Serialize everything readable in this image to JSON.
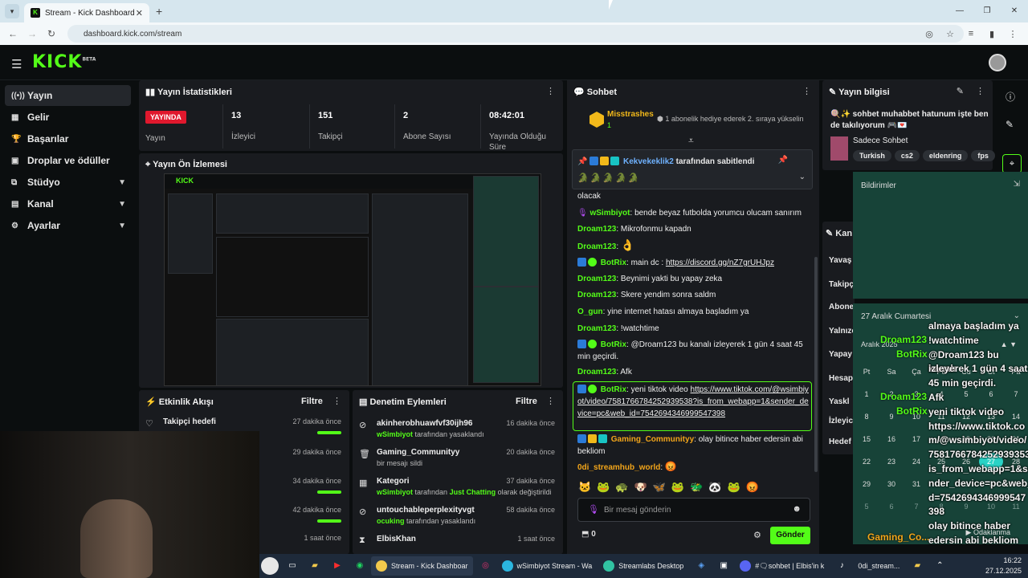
{
  "browser": {
    "tab_title": "Stream - Kick Dashboard",
    "url": "dashboard.kick.com/stream"
  },
  "logo": {
    "text": "KICK",
    "beta": "BETA"
  },
  "sidebar": {
    "items": [
      {
        "label": "Yayın",
        "icon": "radio-icon"
      },
      {
        "label": "Gelir",
        "icon": "money-icon"
      },
      {
        "label": "Başarılar",
        "icon": "trophy-icon"
      },
      {
        "label": "Droplar ve ödüller",
        "icon": "gift-icon"
      },
      {
        "label": "Stüdyo",
        "icon": "studio-icon"
      },
      {
        "label": "Kanal",
        "icon": "channel-icon"
      },
      {
        "label": "Ayarlar",
        "icon": "gear-icon"
      }
    ]
  },
  "stats": {
    "title": "Yayın İstatistikleri",
    "live_badge": "YAYINDA",
    "live_label": "Yayın",
    "items": [
      {
        "value": "13",
        "label": "İzleyici"
      },
      {
        "value": "151",
        "label": "Takipçi"
      },
      {
        "value": "2",
        "label": "Abone Sayısı"
      },
      {
        "value": "08:42:01",
        "label": "Yayında Olduğu Süre"
      }
    ]
  },
  "preview": {
    "title": "Yayın Ön İzlemesi"
  },
  "activity": {
    "title": "Etkinlik Akışı",
    "filter": "Filtre",
    "rows": [
      {
        "title": "Takipçi hedefi",
        "sub": "",
        "time": "27 dakika önce",
        "progress": 1.0
      },
      {
        "title": "",
        "sub": "",
        "time": "29 dakika önce",
        "progress": null
      },
      {
        "title": "",
        "sub": "",
        "time": "34 dakika önce",
        "progress": 1.0
      },
      {
        "title": "",
        "sub": "",
        "time": "42 dakika önce",
        "progress": 1.0
      },
      {
        "title": "",
        "sub": "",
        "time": "1 saat önce",
        "progress": null
      }
    ]
  },
  "moderation": {
    "title": "Denetim Eylemleri",
    "filter": "Filtre",
    "rows": [
      {
        "title": "akinherobhuawfvf30ijh96",
        "user": "wSimbiyot",
        "rest": " tarafından yasaklandı",
        "time": "16 dakika önce",
        "icon": "ban-icon"
      },
      {
        "title": "Gaming_Communityy",
        "user": "",
        "rest": "bir mesajı sildi",
        "time": "20 dakika önce",
        "icon": "trash-icon"
      },
      {
        "title": "Kategori",
        "user": "wSimbiyot",
        "rest": " tarafından ",
        "extra": "Just Chatting",
        "rest2": " olarak değiştirildi",
        "time": "37 dakika önce",
        "icon": "category-icon"
      },
      {
        "title": "untouchableperplexityvgt",
        "user": "ocuking",
        "rest": " tarafından yasaklandı",
        "time": "58 dakika önce",
        "icon": "ban-icon"
      },
      {
        "title": "ElbisKhan",
        "user": "",
        "rest": "",
        "time": "1 saat önce",
        "icon": "hourglass-icon"
      }
    ]
  },
  "chat": {
    "title": "Sohbet",
    "top_user": "Misstrashes",
    "top_count": "1",
    "gift_text": "1 abonelik hediye ederek 2. sıraya yükselin",
    "pinned_user": "Kekvekeklik2",
    "pinned_text": "tarafından sabitlendi",
    "messages": [
      {
        "user": "",
        "text": "olacak",
        "color": "#eeeeee"
      },
      {
        "user": "wSimbiyot",
        "text": "bende beyaz futbolda yorumcu olucam sanırım",
        "color": "#53fc18"
      },
      {
        "user": "Droam123",
        "text": "Mikrofonmu kapadn",
        "color": "#53fc18"
      },
      {
        "user": "Droam123",
        "text": "👌",
        "color": "#53fc18"
      },
      {
        "user": "BotRix",
        "text": "main dc : ",
        "link": "https://discord.gg/nZ7grUHJpz",
        "color": "#53fc18"
      },
      {
        "user": "Droam123",
        "text": "Beynimi yakti bu yapay zeka",
        "color": "#53fc18"
      },
      {
        "user": "Droam123",
        "text": "Skere yendim sonra saldm",
        "color": "#53fc18"
      },
      {
        "user": "O_gun",
        "text": "yine internet hatası almaya başladım ya",
        "color": "#53fc18"
      },
      {
        "user": "Droam123",
        "text": "!watchtime",
        "color": "#53fc18"
      },
      {
        "user": "BotRix",
        "text": "@Droam123 bu kanalı izleyerek 1 gün 4 saat 45 min geçirdi.",
        "color": "#53fc18"
      },
      {
        "user": "Droam123",
        "text": "Afk",
        "color": "#53fc18"
      },
      {
        "user": "BotRix",
        "text": "yeni tiktok video",
        "link": "https://www.tiktok.com/@wsimbiyot/video/7581766784252939538?is_from_webapp=1&sender_device=pc&web_id=7542694346999547398",
        "color": "#53fc18"
      },
      {
        "user": "Gaming_Communityy",
        "text": "olay bitince haber edersin abi bekliom",
        "color": "#f2a51a"
      },
      {
        "user": "0di_streamhub_world",
        "text": "😡",
        "color": "#f2a51a"
      }
    ],
    "input_placeholder": "Bir mesaj gönderin",
    "points": "0",
    "send_label": "Gönder"
  },
  "stream_info": {
    "title": "Yayın bilgisi",
    "stream_title": "🍭✨ sohbet muhabbet hatunum işte ben de takılıyorum 🎮💌",
    "category": "Sadece Sohbet",
    "tags": [
      "Turkish",
      "cs2",
      "eldenring",
      "fps"
    ]
  },
  "notifications": {
    "title": "Bildirimler"
  },
  "channel_partial": {
    "title": "Kan",
    "labels": [
      "Yavaş",
      "Takipç",
      "Abone",
      "Yalnızc",
      "Yapay",
      "Hesap",
      "Yaskl",
      "İzleyic",
      "Hedef"
    ]
  },
  "calendar": {
    "title": "27 Aralık Cumartesi",
    "month": "Aralık 2025",
    "weekdays": [
      "Pt",
      "Sa",
      "Ça",
      "Pe",
      "Cu",
      "Ct",
      "Pa"
    ],
    "days": [
      "1",
      "2",
      "3",
      "4",
      "5",
      "6",
      "7",
      "8",
      "9",
      "10",
      "11",
      "12",
      "13",
      "14",
      "15",
      "16",
      "17",
      "18",
      "19",
      "20",
      "21",
      "22",
      "23",
      "24",
      "25",
      "26",
      "27",
      "28",
      "29",
      "30",
      "31",
      "1",
      "2",
      "3",
      "4",
      "5",
      "6",
      "7",
      "8",
      "9",
      "10",
      "11"
    ],
    "today": "27",
    "focus": "Odaklanma"
  },
  "overlay_chat": {
    "lines": [
      "almaya başladım ya",
      "!watchtime",
      "@Droam123 bu kanalı",
      "izleyerek 1 gün 4 saat",
      "45 min geçirdi.",
      "Afk",
      "yeni tiktok video",
      "https://www.tiktok.co",
      "m/@wsimbiyot/video/",
      "75817667842529393538?",
      "is_from_webapp=1&se",
      "nder_device=pc&web_i",
      "d=7542694346999547",
      "398",
      "olay bitince haber",
      "edersin abi bekliom"
    ],
    "names": [
      "Droam123",
      "BotRix",
      "Droam123",
      "BotRix",
      "Gaming_Co..."
    ]
  },
  "taskbar": {
    "apps": [
      "Stream - Kick Dashboar",
      "wSimbiyot Stream - Wa",
      "Streamlabs Desktop",
      "#🗨sohbet | Elbis'in k",
      "0di_stream..."
    ],
    "time": "16:22",
    "date": "27.12.2025"
  }
}
